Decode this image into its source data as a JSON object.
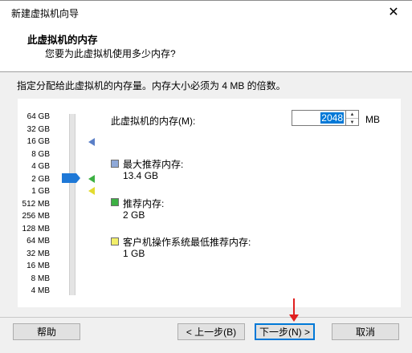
{
  "window": {
    "title": "新建虚拟机向导",
    "close_glyph": "✕"
  },
  "header": {
    "heading": "此虚拟机的内存",
    "subheading": "您要为此虚拟机使用多少内存?"
  },
  "instruction": "指定分配给此虚拟机的内存量。内存大小必须为 4 MB 的倍数。",
  "scale": {
    "labels": [
      "64 GB",
      "32 GB",
      "16 GB",
      "8 GB",
      "4 GB",
      "2 GB",
      "1 GB",
      "512 MB",
      "256 MB",
      "128 MB",
      "64 MB",
      "32 MB",
      "16 MB",
      "8 MB",
      "4 MB"
    ],
    "selected": "2 GB"
  },
  "memory": {
    "label": "此虚拟机的内存(M):",
    "value": "2048",
    "unit": "MB"
  },
  "legend": {
    "max": {
      "title": "最大推荐内存:",
      "value": "13.4 GB",
      "color": "#8fa9d8"
    },
    "recommended": {
      "title": "推荐内存:",
      "value": "2 GB",
      "color": "#3cb043"
    },
    "minimum": {
      "title": "客户机操作系统最低推荐内存:",
      "value": "1 GB",
      "color": "#f2ef6a"
    }
  },
  "buttons": {
    "help": "帮助",
    "back": "< 上一步(B)",
    "next": "下一步(N) >",
    "cancel": "取消"
  },
  "colors": {
    "accent": "#0078d7",
    "annotation_arrow": "#e02020"
  }
}
